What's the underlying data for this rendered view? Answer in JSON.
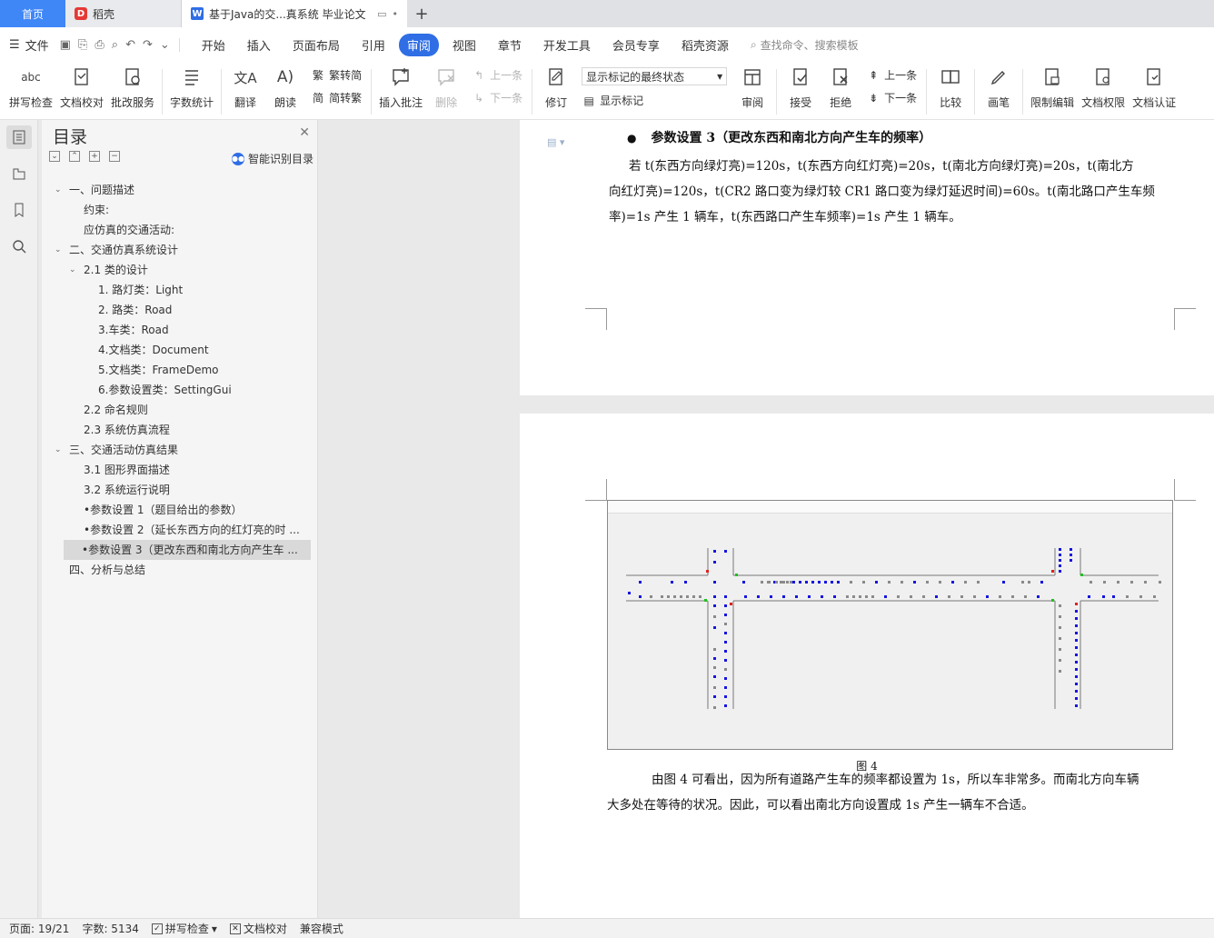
{
  "tabs": {
    "home": "首页",
    "daoke": "稻壳",
    "doc": "基于Java的交...真系统 毕业论文",
    "add": "+"
  },
  "menu": {
    "file": "文件",
    "items": [
      "开始",
      "插入",
      "页面布局",
      "引用",
      "审阅",
      "视图",
      "章节",
      "开发工具",
      "会员专享",
      "稻壳资源"
    ],
    "active": "审阅",
    "search": "查找命令、搜索模板"
  },
  "ribbon": {
    "spell": "拼写检查",
    "proof": "文档校对",
    "batch": "批改服务",
    "wordcount": "字数统计",
    "translate": "翻译",
    "read": "朗读",
    "t2s": "繁转简",
    "s2t": "简转繁",
    "insert_comment": "插入批注",
    "delete": "删除",
    "prev_comment": "上一条",
    "next_comment": "下一条",
    "revise": "修订",
    "markup_state": "显示标记的最终状态",
    "show_markup": "显示标记",
    "review": "审阅",
    "accept": "接受",
    "reject": "拒绝",
    "prev": "上一条",
    "next": "下一条",
    "compare": "比较",
    "pen": "画笔",
    "restrict": "限制编辑",
    "permission": "文档权限",
    "certify": "文档认证"
  },
  "toc": {
    "title": "目录",
    "smart": "智能识别目录",
    "items": [
      {
        "text": "一、问题描述",
        "level": 1,
        "caret": true
      },
      {
        "text": "约束:",
        "level": 2,
        "caret": false
      },
      {
        "text": "应仿真的交通活动:",
        "level": 2,
        "caret": false
      },
      {
        "text": "二、交通仿真系统设计",
        "level": 1,
        "caret": true
      },
      {
        "text": "2.1 类的设计",
        "level": 2,
        "caret": true
      },
      {
        "text": "1. 路灯类：Light",
        "level": 3,
        "caret": false
      },
      {
        "text": "2. 路类：Road",
        "level": 3,
        "caret": false
      },
      {
        "text": "3.车类：Road",
        "level": 3,
        "caret": false
      },
      {
        "text": "4.文档类：Document",
        "level": 3,
        "caret": false
      },
      {
        "text": "5.文档类：FrameDemo",
        "level": 3,
        "caret": false
      },
      {
        "text": "6.参数设置类：SettingGui",
        "level": 3,
        "caret": false
      },
      {
        "text": "2.2 命名规则",
        "level": 2,
        "caret": false
      },
      {
        "text": "2.3 系统仿真流程",
        "level": 2,
        "caret": false
      },
      {
        "text": "三、交通活动仿真结果",
        "level": 1,
        "caret": true
      },
      {
        "text": "3.1 图形界面描述",
        "level": 2,
        "caret": false
      },
      {
        "text": "3.2 系统运行说明",
        "level": 2,
        "caret": false
      },
      {
        "text": "•参数设置 1（题目给出的参数）",
        "level": 2,
        "caret": false
      },
      {
        "text": "•参数设置 2（延长东西方向的红灯亮的时 ...",
        "level": 2,
        "caret": false
      },
      {
        "text": "•参数设置 3（更改东西和南北方向产生车 ...",
        "level": 2,
        "caret": false,
        "selected": true
      },
      {
        "text": "四、分析与总结",
        "level": 1,
        "caret": false
      }
    ]
  },
  "doc": {
    "heading": "参数设置 3（更改东西和南北方向产生车的频率）",
    "para1_line1": "若 t(东西方向绿灯亮)=120s，t(东西方向红灯亮)=20s，t(南北方向绿灯亮)=20s，t(南北方",
    "para1_line2": "向红灯亮)=120s，t(CR2 路口变为绿灯较 CR1 路口变为绿灯延迟时间)=60s。t(南北路口产生车频",
    "para1_line3": "率)=1s 产生 1 辆车，t(东西路口产生车频率)=1s 产生 1 辆车。",
    "caption": "图 4",
    "para2_line1": "由图 4 可看出，因为所有道路产生车的频率都设置为 1s，所以车非常多。而南北方向车辆",
    "para2_line2": "大多处在等待的状况。因此，可以看出南北方向设置成 1s 产生一辆车不合适。"
  },
  "status": {
    "page": "页面: 19/21",
    "words": "字数: 5134",
    "spell": "拼写检查",
    "proof": "文档校对",
    "compat": "兼容模式"
  },
  "colors": {
    "accent": "#2f6ee5",
    "car_blue": "#1515e0",
    "car_gray": "#8a8a8a",
    "light_red": "#e02020",
    "light_green": "#22c022"
  }
}
